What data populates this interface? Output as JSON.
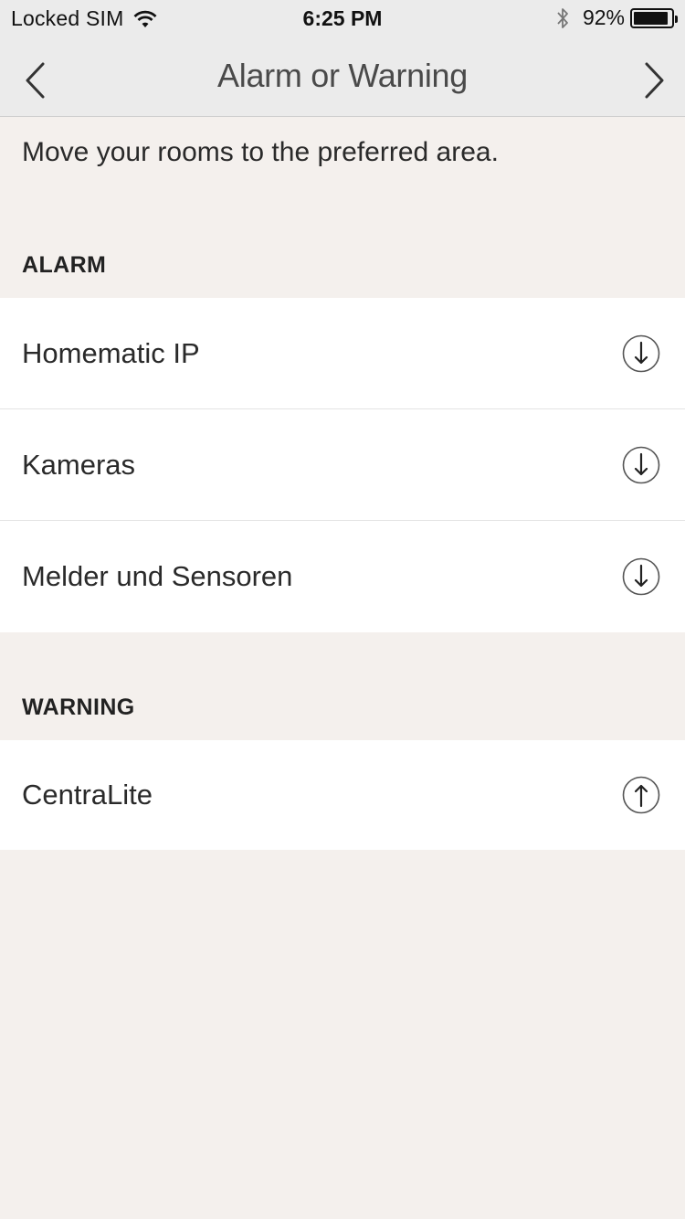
{
  "status_bar": {
    "carrier": "Locked SIM",
    "time": "6:25 PM",
    "battery_percent": "92%",
    "battery_level": 0.92
  },
  "nav": {
    "title": "Alarm or Warning",
    "back_icon": "chevron-left-icon",
    "next_icon": "chevron-right-icon"
  },
  "instruction": "Move your rooms to the preferred area.",
  "sections": {
    "alarm": {
      "header": "ALARM",
      "items": [
        {
          "label": "Homematic IP",
          "action_icon": "arrow-down-circle-icon"
        },
        {
          "label": "Kameras",
          "action_icon": "arrow-down-circle-icon"
        },
        {
          "label": "Melder und Sensoren",
          "action_icon": "arrow-down-circle-icon"
        }
      ]
    },
    "warning": {
      "header": "WARNING",
      "items": [
        {
          "label": "CentraLite",
          "action_icon": "arrow-up-circle-icon"
        }
      ]
    }
  },
  "colors": {
    "background": "#f4f0ed",
    "nav_background": "#ebebeb",
    "row_background": "#ffffff"
  }
}
